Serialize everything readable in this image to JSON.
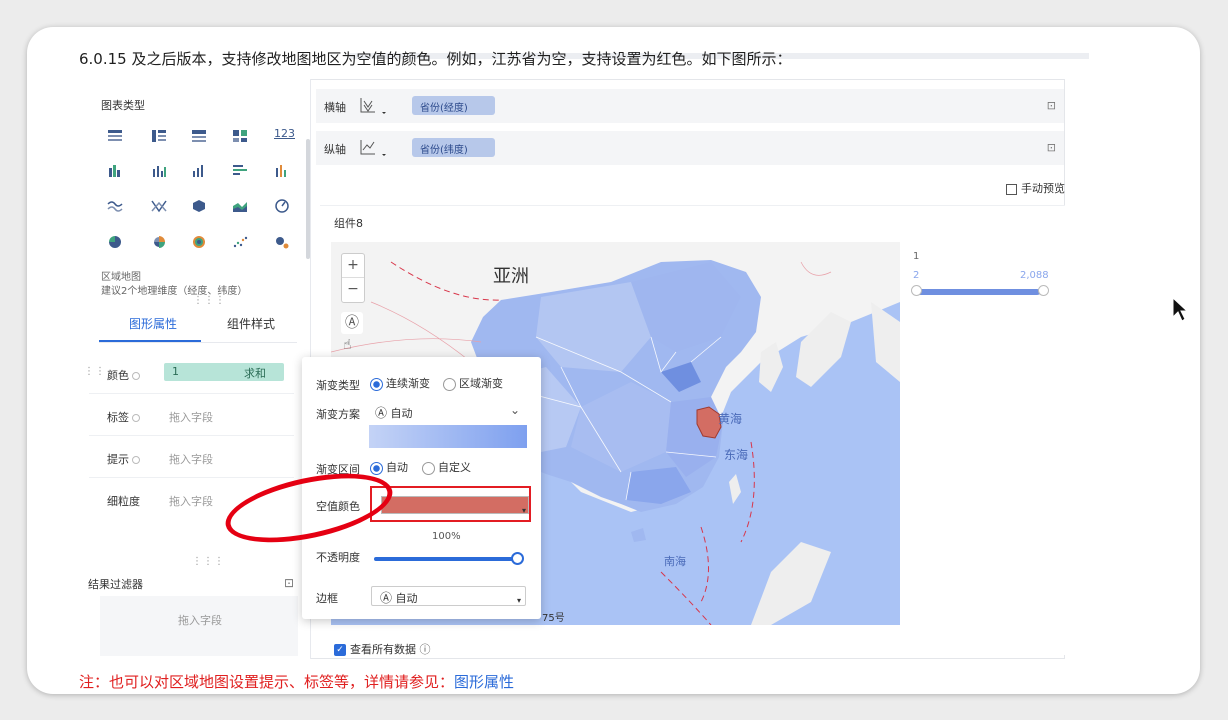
{
  "intro_text": "6.0.15 及之后版本，支持修改地图地区为空值的颜色。例如，江苏省为空，支持设置为红色。如下图所示：",
  "left_panel": {
    "chart_type_title": "图表类型",
    "type_icon_text_123": "123",
    "hint_line1": "区域地图",
    "hint_line2": "建议2个地理维度（经度、纬度）",
    "tabs": [
      "图形属性",
      "组件样式"
    ],
    "fields": [
      {
        "label": "颜色",
        "pill_value": "1",
        "pill_agg": "求和"
      },
      {
        "label": "标签",
        "placeholder": "拖入字段"
      },
      {
        "label": "提示",
        "placeholder": "拖入字段"
      },
      {
        "label": "细粒度",
        "placeholder": "拖入字段"
      }
    ],
    "result_filter": "结果过滤器",
    "filter_placeholder": "拖入字段"
  },
  "axes": {
    "x_label": "横轴",
    "x_field": "省份(经度)",
    "y_label": "纵轴",
    "y_field": "省份(纬度)"
  },
  "manual_preview": "手动预览",
  "chart": {
    "component_title": "组件8",
    "map_labels": {
      "asia": "亚洲",
      "yellow_sea": "黄海",
      "east_sea": "东海",
      "south_sea": "南海",
      "approval": "75号"
    },
    "legend": {
      "title": "1",
      "min": "2",
      "max": "2,088",
      "fill_fraction": 0.97
    },
    "view_all": "查看所有数据"
  },
  "popup": {
    "gradient_type_label": "渐变类型",
    "gradient_type_options": [
      "连续渐变",
      "区域渐变"
    ],
    "gradient_scheme_label": "渐变方案",
    "gradient_scheme_value": "自动",
    "gradient_range_label": "渐变区间",
    "gradient_range_options": [
      "自动",
      "自定义"
    ],
    "null_color_label": "空值颜色",
    "null_color": "#d36d63",
    "opacity_pct": "100%",
    "opacity_label": "不透明度",
    "border_label": "边框",
    "border_value": "自动"
  },
  "note": {
    "prefix": "注：也可以对区域地图设置提示、标签等，详情请参见：",
    "link": "图形属性"
  },
  "colors": {
    "accent": "#2b6bd9",
    "null_red": "#d36d63",
    "annotation_red": "#e50012"
  }
}
